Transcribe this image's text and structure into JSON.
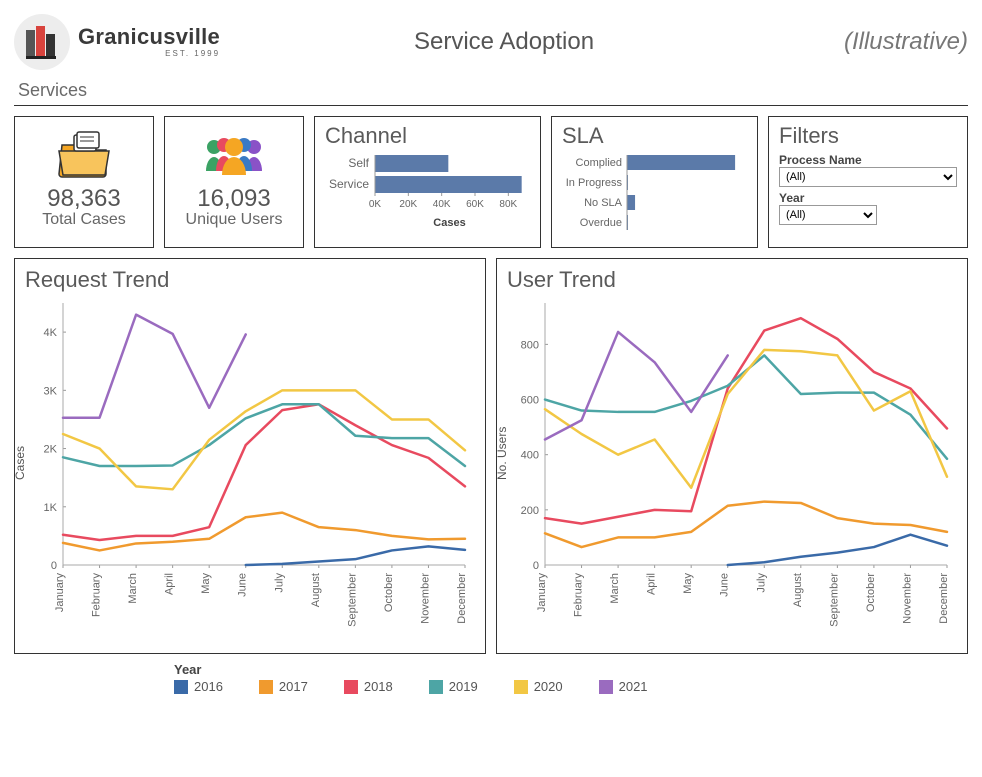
{
  "header": {
    "brand_name": "Granicusville",
    "brand_sub": "EST. 1999",
    "title": "Service Adoption",
    "illustrative": "(Illustrative)"
  },
  "section_label": "Services",
  "kpis": {
    "total_cases_value": "98,363",
    "total_cases_label": "Total Cases",
    "unique_users_value": "16,093",
    "unique_users_label": "Unique Users"
  },
  "channel": {
    "title": "Channel",
    "axis_title": "Cases",
    "ticks": [
      "0K",
      "20K",
      "40K",
      "60K",
      "80K"
    ]
  },
  "sla": {
    "title": "SLA"
  },
  "filters": {
    "title": "Filters",
    "process_label": "Process Name",
    "process_value": "(All)",
    "year_label": "Year",
    "year_value": "(All)"
  },
  "trends": {
    "request_title": "Request Trend",
    "request_ylabel": "Cases",
    "user_title": "User Trend",
    "user_ylabel": "No. Users",
    "months": [
      "January",
      "February",
      "March",
      "April",
      "May",
      "June",
      "July",
      "August",
      "September",
      "October",
      "November",
      "December"
    ],
    "legend_title": "Year"
  },
  "legend_items": [
    {
      "name": "2016",
      "color": "#3a6aa8"
    },
    {
      "name": "2017",
      "color": "#f09a2e"
    },
    {
      "name": "2018",
      "color": "#e84a5f"
    },
    {
      "name": "2019",
      "color": "#4da5a5"
    },
    {
      "name": "2020",
      "color": "#f2c744"
    },
    {
      "name": "2021",
      "color": "#9a6bbf"
    }
  ],
  "chart_data": [
    {
      "type": "bar",
      "title": "Channel",
      "xlabel": "Cases",
      "ylabel": "",
      "categories": [
        "Self",
        "Service"
      ],
      "values": [
        44000,
        88000
      ],
      "xlim": [
        0,
        90000
      ]
    },
    {
      "type": "bar",
      "title": "SLA",
      "xlabel": "",
      "ylabel": "",
      "categories": [
        "Complied",
        "In Progress",
        "No SLA",
        "Overdue"
      ],
      "values": [
        94000,
        800,
        7000,
        200
      ],
      "xlim": [
        0,
        100000
      ]
    },
    {
      "type": "line",
      "title": "Request Trend",
      "xlabel": "Month",
      "ylabel": "Cases",
      "ylim": [
        0,
        4500
      ],
      "categories": [
        "January",
        "February",
        "March",
        "April",
        "May",
        "June",
        "July",
        "August",
        "September",
        "October",
        "November",
        "December"
      ],
      "series": [
        {
          "name": "2016",
          "values": [
            null,
            null,
            null,
            null,
            null,
            0,
            20,
            60,
            100,
            250,
            320,
            260
          ]
        },
        {
          "name": "2017",
          "values": [
            380,
            250,
            370,
            400,
            450,
            820,
            900,
            650,
            600,
            500,
            440,
            450
          ]
        },
        {
          "name": "2018",
          "values": [
            520,
            430,
            500,
            500,
            650,
            2060,
            2660,
            2760,
            2400,
            2060,
            1840,
            1350
          ]
        },
        {
          "name": "2019",
          "values": [
            1850,
            1700,
            1700,
            1710,
            2060,
            2520,
            2760,
            2760,
            2220,
            2180,
            2180,
            1700
          ]
        },
        {
          "name": "2020",
          "values": [
            2250,
            2000,
            1350,
            1300,
            2150,
            2640,
            3000,
            3000,
            3000,
            2500,
            2500,
            1970
          ]
        },
        {
          "name": "2021",
          "values": [
            2530,
            2530,
            4300,
            3970,
            2700,
            3960,
            null,
            null,
            null,
            null,
            null,
            null
          ]
        }
      ]
    },
    {
      "type": "line",
      "title": "User Trend",
      "xlabel": "Month",
      "ylabel": "No. Users",
      "ylim": [
        0,
        950
      ],
      "categories": [
        "January",
        "February",
        "March",
        "April",
        "May",
        "June",
        "July",
        "August",
        "September",
        "October",
        "November",
        "December"
      ],
      "series": [
        {
          "name": "2016",
          "values": [
            null,
            null,
            null,
            null,
            null,
            0,
            10,
            30,
            45,
            65,
            110,
            70
          ]
        },
        {
          "name": "2017",
          "values": [
            115,
            65,
            100,
            100,
            120,
            215,
            230,
            225,
            170,
            150,
            145,
            120
          ]
        },
        {
          "name": "2018",
          "values": [
            170,
            150,
            175,
            200,
            195,
            640,
            850,
            895,
            820,
            700,
            640,
            495
          ]
        },
        {
          "name": "2019",
          "values": [
            600,
            560,
            555,
            555,
            595,
            650,
            760,
            620,
            625,
            625,
            545,
            385
          ]
        },
        {
          "name": "2020",
          "values": [
            565,
            475,
            400,
            455,
            280,
            620,
            780,
            775,
            760,
            560,
            630,
            320
          ]
        },
        {
          "name": "2021",
          "values": [
            455,
            525,
            845,
            735,
            555,
            760,
            null,
            null,
            null,
            null,
            null,
            null
          ]
        }
      ]
    }
  ]
}
